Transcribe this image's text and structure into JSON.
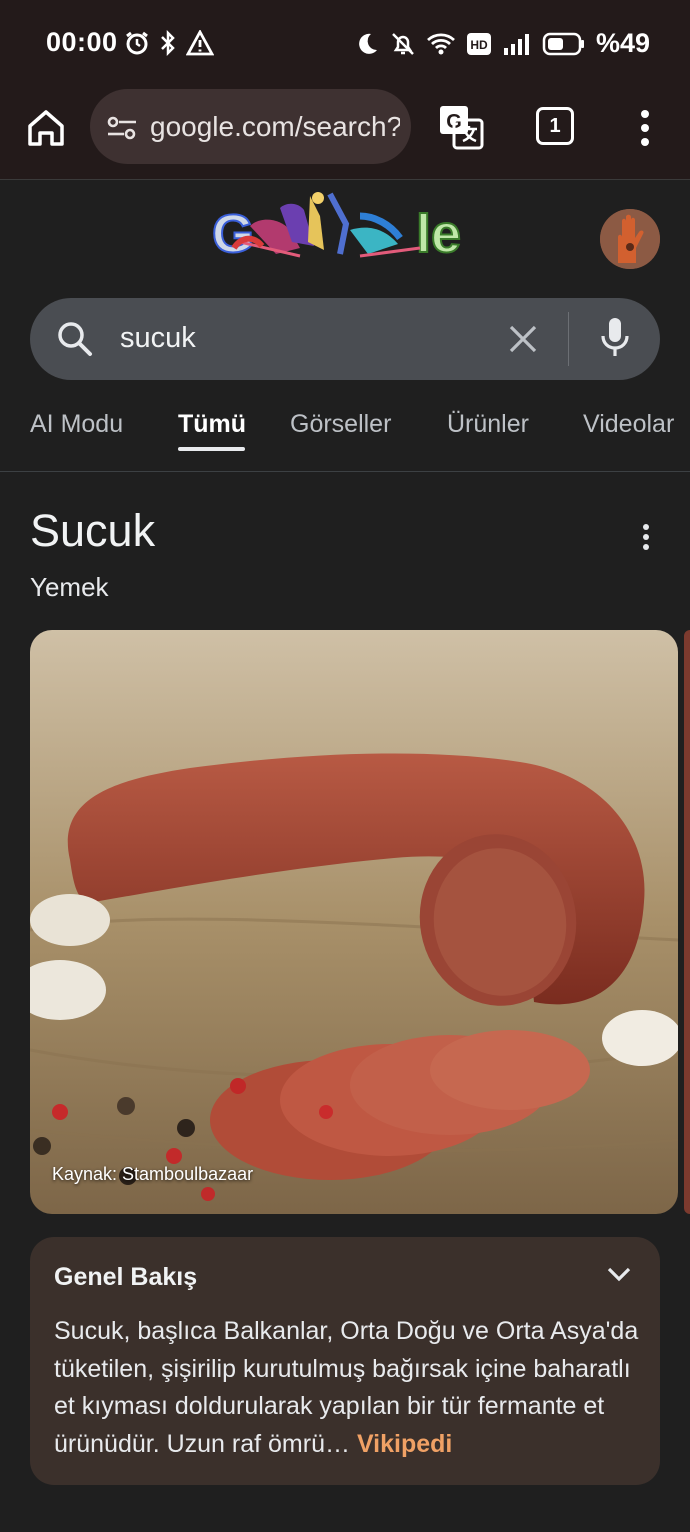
{
  "status_bar": {
    "time": "00:00",
    "battery_percent": "%49",
    "icons": [
      "alarm-icon",
      "bluetooth-icon",
      "warning-icon",
      "moon-icon",
      "bell-off-icon",
      "wifi-icon",
      "hd-icon",
      "signal-icon",
      "battery-icon"
    ]
  },
  "browser": {
    "url": "google.com/search?q=sucuk",
    "tab_count": "1",
    "icons": [
      "home-icon",
      "tune-icon",
      "translate-icon",
      "more-vert-icon"
    ]
  },
  "header": {
    "logo": "Google",
    "avatar": "profile-avatar"
  },
  "search": {
    "query": "sucuk"
  },
  "tabs": [
    {
      "label": "AI Modu"
    },
    {
      "label": "Tümü",
      "active": true
    },
    {
      "label": "Görseller"
    },
    {
      "label": "Ürünler"
    },
    {
      "label": "Videolar"
    }
  ],
  "knowledge_panel": {
    "title": "Sucuk",
    "subtitle": "Yemek",
    "image_source": "Kaynak: Stamboulbazaar",
    "overview": {
      "heading": "Genel Bakış",
      "text": "Sucuk, başlıca Balkanlar, Orta Doğu ve Orta Asya'da tüketilen, şişirilip kurutulmuş bağırsak içine baharatlı et kıyması doldurularak yapılan bir tür fermante et ürünüdür. Uzun raf ömrü",
      "ellipsis": "…",
      "source_link": "Vikipedi"
    }
  },
  "colors": {
    "background": "#1f1f1f",
    "browser_chrome": "#231a1a",
    "search_box": "#4a4d52",
    "overview_card": "#3b302b",
    "link_accent": "#f0a165"
  }
}
